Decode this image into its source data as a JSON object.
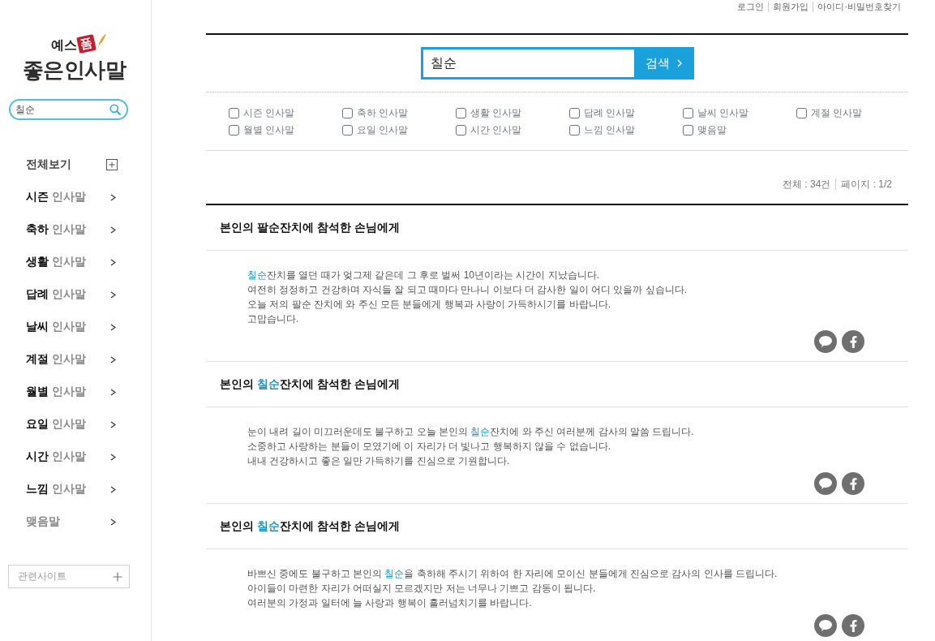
{
  "top_links": [
    "로그인",
    "회원가입",
    "아이디·비밀번호찾기"
  ],
  "sidebar": {
    "logo": {
      "brand": "예스",
      "badge": "폼",
      "title": "좋은인사말"
    },
    "search": {
      "value": "칠순"
    },
    "menu": [
      {
        "kind": "all",
        "label": "전체보기"
      },
      {
        "kind": "category",
        "label": "**시즌** 인사말"
      },
      {
        "kind": "category",
        "label": "**축하** 인사말"
      },
      {
        "kind": "category",
        "label": "**생활** 인사말"
      },
      {
        "kind": "category",
        "label": "**답례** 인사말"
      },
      {
        "kind": "category",
        "label": "**날씨** 인사말"
      },
      {
        "kind": "category",
        "label": "**계절** 인사말"
      },
      {
        "kind": "category",
        "label": "**월별** 인사말"
      },
      {
        "kind": "category",
        "label": "**요일** 인사말"
      },
      {
        "kind": "category",
        "label": "**시간** 인사말"
      },
      {
        "kind": "category",
        "label": "**느낌** 인사말"
      },
      {
        "kind": "category",
        "label": "맺음말"
      }
    ],
    "related_sites": {
      "label": "관련사이트"
    }
  },
  "search": {
    "value": "칠순",
    "button": "검색"
  },
  "filters": [
    {
      "label": "시즌 인사말",
      "checked": false
    },
    {
      "label": "축하 인사말",
      "checked": false
    },
    {
      "label": "생활 인사말",
      "checked": false
    },
    {
      "label": "답례 인사말",
      "checked": false
    },
    {
      "label": "날씨 인사말",
      "checked": false
    },
    {
      "label": "계절 인사말",
      "checked": false
    },
    {
      "label": "월별 인사말",
      "checked": false
    },
    {
      "label": "요일 인사말",
      "checked": false
    },
    {
      "label": "시간 인사말",
      "checked": false
    },
    {
      "label": "느낌 인사말",
      "checked": false
    },
    {
      "label": "맺음말",
      "checked": false
    }
  ],
  "summary": {
    "total": "전체 : 34건",
    "page": "페이지 : 1/2"
  },
  "results": [
    {
      "title": [
        {
          "text": "본인의 팔순잔치에 참석한 손님에게",
          "highlight": false
        }
      ],
      "body": [
        [
          {
            "text": "칠순",
            "highlight": true
          },
          {
            "text": "잔치를 열던 때가 엊그제 같은데 그 후로 벌써 10년이라는 시간이 지났습니다.",
            "highlight": false
          }
        ],
        [
          {
            "text": "여전히 정정하고 건강하며 자식들 잘 되고 때마다 만나니 이보다 더 감사한 일이 어디 있을까 싶습니다.",
            "highlight": false
          }
        ],
        [
          {
            "text": "오늘 저의 팔순 잔치에 와 주신 모든 분들에게 행복과 사랑이 가득하시기를 바랍니다.",
            "highlight": false
          }
        ],
        [
          {
            "text": "고맙습니다.",
            "highlight": false
          }
        ]
      ]
    },
    {
      "title": [
        {
          "text": "본인의 ",
          "highlight": false
        },
        {
          "text": "칠순",
          "highlight": true
        },
        {
          "text": "잔치에 참석한 손님에게",
          "highlight": false
        }
      ],
      "body": [
        [
          {
            "text": "눈이 내려 길이 미끄러운데도 불구하고 오늘 본인의 ",
            "highlight": false
          },
          {
            "text": "칠순",
            "highlight": true
          },
          {
            "text": "잔치에 와 주신 여러분께 감사의 말씀 드립니다.",
            "highlight": false
          }
        ],
        [
          {
            "text": "소중하고 사랑하는 분들이 모였기에 이 자리가 더 빛나고 행복하지 않을 수 없습니다.",
            "highlight": false
          }
        ],
        [
          {
            "text": "내내 건강하시고 좋은 일만 가득하기를 진심으로 기원합니다.",
            "highlight": false
          }
        ]
      ]
    },
    {
      "title": [
        {
          "text": "본인의 ",
          "highlight": false
        },
        {
          "text": "칠순",
          "highlight": true
        },
        {
          "text": "잔치에 참석한 손님에게",
          "highlight": false
        }
      ],
      "body": [
        [
          {
            "text": "바쁘신 중에도 불구하고 본인의 ",
            "highlight": false
          },
          {
            "text": "칠순",
            "highlight": true
          },
          {
            "text": "을 축하해 주시기 위하여 한 자리에 모이신 분들에게 진심으로 감사의 인사를 드립니다.",
            "highlight": false
          }
        ],
        [
          {
            "text": "아이들이 마련한 자리가 어떠실지 모르겠지만 저는 너무나 기쁘고 감동이 됩니다.",
            "highlight": false
          }
        ],
        [
          {
            "text": "여러분의 가정과 일터에 늘 사랑과 행복이 흘러넘치기를 바랍니다.",
            "highlight": false
          }
        ]
      ]
    }
  ]
}
